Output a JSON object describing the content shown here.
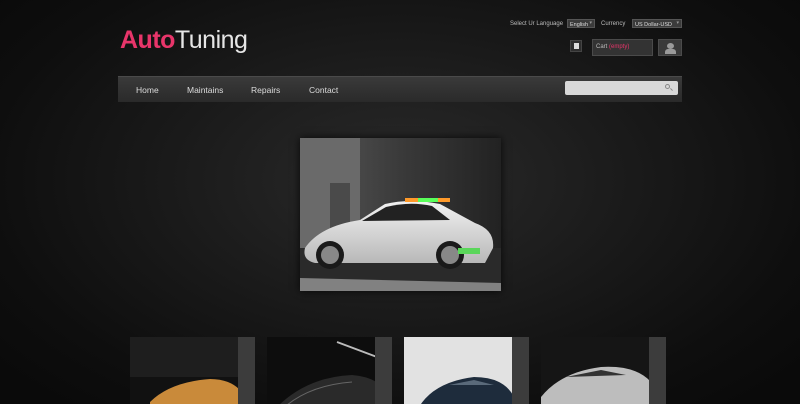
{
  "logo": {
    "part1": "Auto",
    "part2": "Tuning"
  },
  "header": {
    "language_label": "Select Ur Language",
    "language_value": "English",
    "currency_label": "Currency",
    "currency_value": "US Dollar-USD",
    "cart_label": "Cart",
    "cart_count": "(empty)"
  },
  "nav": {
    "items": [
      "Home",
      "Maintains",
      "Repairs",
      "Contact"
    ]
  },
  "search": {
    "placeholder": ""
  },
  "icons": {
    "cart": "document-icon",
    "user": "user-icon",
    "search": "search-icon"
  },
  "colors": {
    "accent": "#e8356a",
    "background": "#111111"
  }
}
